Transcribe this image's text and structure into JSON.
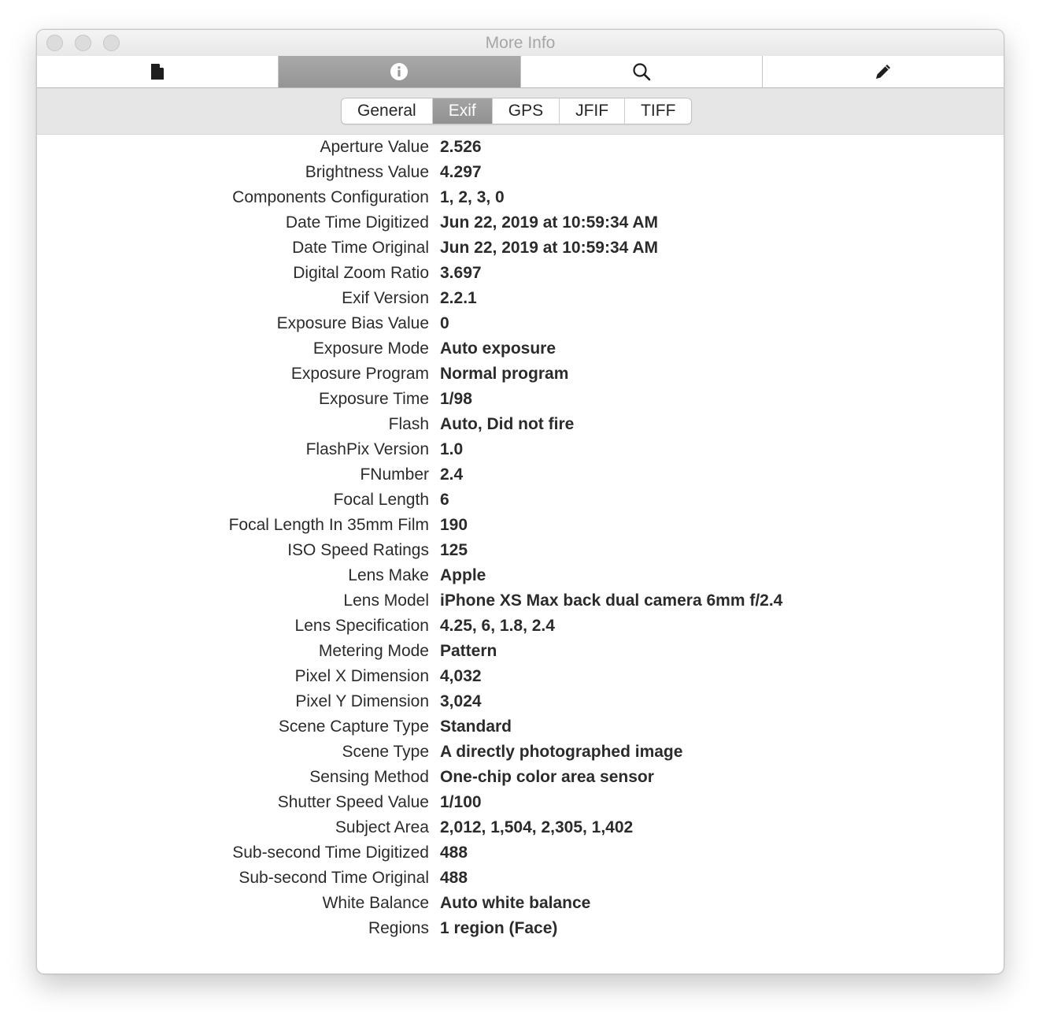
{
  "window": {
    "title": "More Info"
  },
  "toolbar": {
    "tabs": [
      {
        "icon": "document-icon",
        "selected": false
      },
      {
        "icon": "info-icon",
        "selected": true
      },
      {
        "icon": "magnifier-icon",
        "selected": false
      },
      {
        "icon": "pencil-icon",
        "selected": false
      }
    ]
  },
  "segments": [
    {
      "label": "General",
      "selected": false
    },
    {
      "label": "Exif",
      "selected": true
    },
    {
      "label": "GPS",
      "selected": false
    },
    {
      "label": "JFIF",
      "selected": false
    },
    {
      "label": "TIFF",
      "selected": false
    }
  ],
  "exif": {
    "rows": [
      {
        "label": "Aperture Value",
        "value": "2.526"
      },
      {
        "label": "Brightness Value",
        "value": "4.297"
      },
      {
        "label": "Components Configuration",
        "value": "1, 2, 3, 0"
      },
      {
        "label": "Date Time Digitized",
        "value": "Jun 22, 2019 at 10:59:34 AM"
      },
      {
        "label": "Date Time Original",
        "value": "Jun 22, 2019 at 10:59:34 AM"
      },
      {
        "label": "Digital Zoom Ratio",
        "value": "3.697"
      },
      {
        "label": "Exif Version",
        "value": "2.2.1"
      },
      {
        "label": "Exposure Bias Value",
        "value": "0"
      },
      {
        "label": "Exposure Mode",
        "value": "Auto exposure"
      },
      {
        "label": "Exposure Program",
        "value": "Normal program"
      },
      {
        "label": "Exposure Time",
        "value": "1/98"
      },
      {
        "label": "Flash",
        "value": "Auto, Did not fire"
      },
      {
        "label": "FlashPix Version",
        "value": "1.0"
      },
      {
        "label": "FNumber",
        "value": "2.4"
      },
      {
        "label": "Focal Length",
        "value": "6"
      },
      {
        "label": "Focal Length In 35mm Film",
        "value": "190"
      },
      {
        "label": "ISO Speed Ratings",
        "value": "125"
      },
      {
        "label": "Lens Make",
        "value": "Apple"
      },
      {
        "label": "Lens Model",
        "value": "iPhone XS Max back dual camera 6mm f/2.4"
      },
      {
        "label": "Lens Specification",
        "value": "4.25, 6, 1.8, 2.4"
      },
      {
        "label": "Metering Mode",
        "value": "Pattern"
      },
      {
        "label": "Pixel X Dimension",
        "value": "4,032"
      },
      {
        "label": "Pixel Y Dimension",
        "value": "3,024"
      },
      {
        "label": "Scene Capture Type",
        "value": "Standard"
      },
      {
        "label": "Scene Type",
        "value": "A directly photographed image"
      },
      {
        "label": "Sensing Method",
        "value": "One-chip color area sensor"
      },
      {
        "label": "Shutter Speed Value",
        "value": "1/100"
      },
      {
        "label": "Subject Area",
        "value": "2,012, 1,504, 2,305, 1,402"
      },
      {
        "label": "Sub-second Time Digitized",
        "value": "488"
      },
      {
        "label": "Sub-second Time Original",
        "value": "488"
      },
      {
        "label": "White Balance",
        "value": "Auto white balance"
      },
      {
        "label": "Regions",
        "value": "1 region (Face)"
      }
    ]
  }
}
